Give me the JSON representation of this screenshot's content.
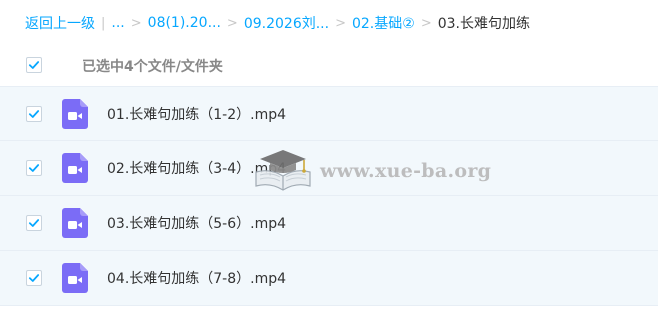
{
  "breadcrumb": {
    "back_label": "返回上一级",
    "divider": "|",
    "ellipsis": "...",
    "separator": ">",
    "items": [
      "08(1).20...",
      "09.2026刘...",
      "02.基础②"
    ],
    "current": "03.长难句加练"
  },
  "selection": {
    "all_checked": true,
    "label": "已选中4个文件/文件夹"
  },
  "files": [
    {
      "name": "01.长难句加练（1-2）.mp4",
      "checked": true,
      "icon": "video-file-icon"
    },
    {
      "name": "02.长难句加练（3-4）.mp4",
      "checked": true,
      "icon": "video-file-icon"
    },
    {
      "name": "03.长难句加练（5-6）.mp4",
      "checked": true,
      "icon": "video-file-icon"
    },
    {
      "name": "04.长难句加练（7-8）.mp4",
      "checked": true,
      "icon": "video-file-icon"
    }
  ],
  "watermark": {
    "text": "www.xue-ba.org",
    "icon": "graduation-cap-book-icon"
  },
  "colors": {
    "accent": "#06a7ff",
    "row_background": "#f2f8fc",
    "file_icon": "#7b6cf6",
    "checkmark": "#06a7ff"
  }
}
